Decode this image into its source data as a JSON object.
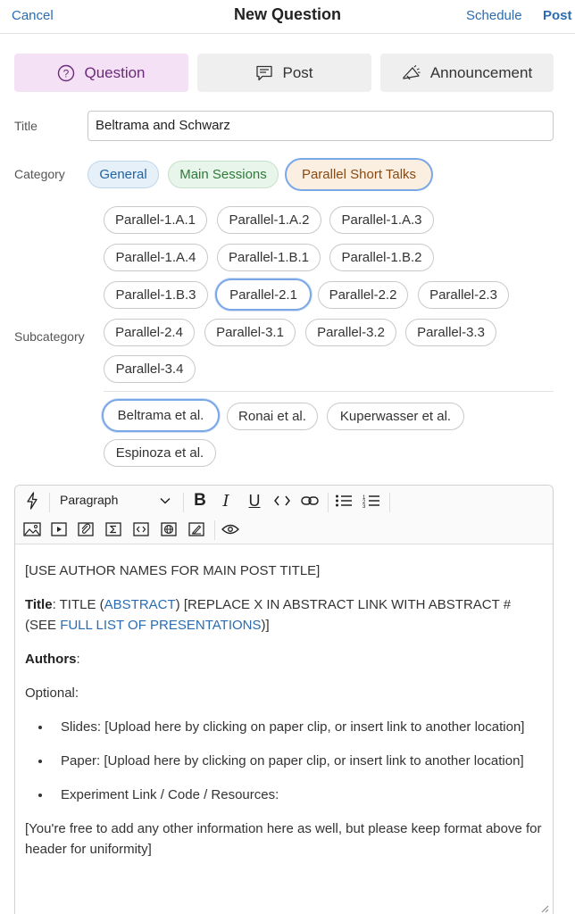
{
  "header": {
    "cancel_label": "Cancel",
    "title": "New Question",
    "schedule_label": "Schedule",
    "post_label": "Post"
  },
  "post_types": [
    {
      "label": "Question",
      "icon": "question-circle-icon",
      "active": true
    },
    {
      "label": "Post",
      "icon": "note-icon",
      "active": false
    },
    {
      "label": "Announcement",
      "icon": "megaphone-icon",
      "active": false
    }
  ],
  "form": {
    "title_label": "Title",
    "title_value": "Beltrama and Schwarz",
    "category_label": "Category",
    "subcategory_label": "Subcategory"
  },
  "categories": [
    {
      "label": "General"
    },
    {
      "label": "Main Sessions"
    },
    {
      "label": "Parallel Short Talks",
      "selected": true
    }
  ],
  "subcategories": [
    "Parallel-1.A.1",
    "Parallel-1.A.2",
    "Parallel-1.A.3",
    "Parallel-1.A.4",
    "Parallel-1.B.1",
    "Parallel-1.B.2",
    "Parallel-1.B.3",
    "Parallel-2.1",
    "Parallel-2.2",
    "Parallel-2.3",
    "Parallel-2.4",
    "Parallel-3.1",
    "Parallel-3.2",
    "Parallel-3.3",
    "Parallel-3.4"
  ],
  "selected_subcategory": "Parallel-2.1",
  "talks": [
    "Beltrama et al.",
    "Ronai et al.",
    "Kuperwasser et al.",
    "Espinoza et al."
  ],
  "selected_talk": "Beltrama et al.",
  "editor": {
    "paragraph_style": "Paragraph",
    "bold_glyph": "B",
    "italic_glyph": "I",
    "underline_glyph": "U",
    "line1": "[USE AUTHOR NAMES FOR MAIN POST TITLE]",
    "title_bold": "Title",
    "title_text1": ": TITLE (",
    "title_link1": "ABSTRACT",
    "title_text2": ") [REPLACE X IN ABSTRACT LINK WITH ABSTRACT # (SEE ",
    "title_link2": "FULL LIST OF PRESENTATIONS",
    "title_text3": ")]",
    "authors_bold": "Authors",
    "authors_colon": ":",
    "optional": "Optional:",
    "bullets": [
      "Slides: [Upload here by clicking on paper clip, or insert link to another location]",
      "Paper: [Upload here by clicking on paper clip, or insert link to another location]",
      "Experiment Link / Code / Resources:"
    ],
    "footer_text": "[You're free to add any other information here as well, but please keep format above for header for uniformity]"
  },
  "colors": {
    "accent": "#2b6cb0",
    "question_tab_bg": "#f5e1f5",
    "selected_border": "#7aa7e6"
  }
}
